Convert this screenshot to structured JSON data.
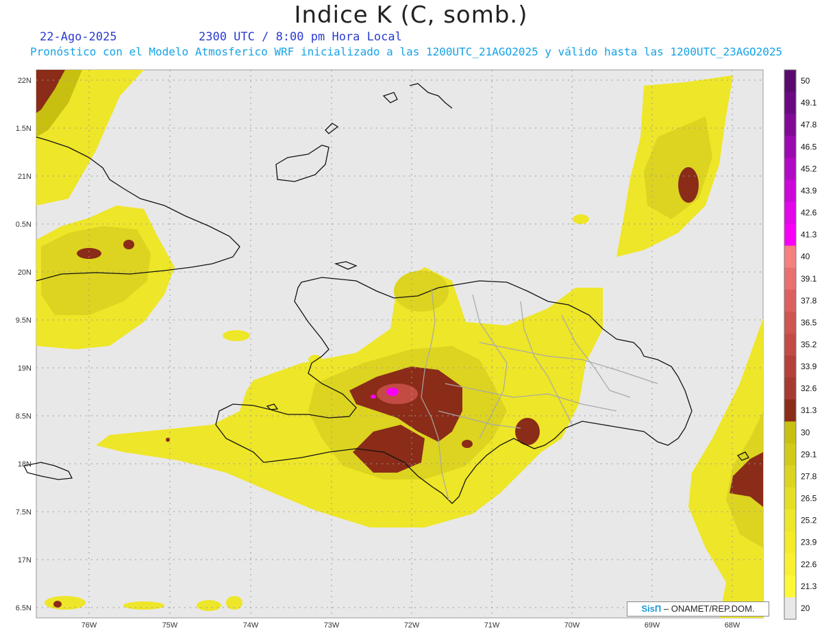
{
  "header": {
    "title": "Indice K (C, somb.)",
    "date": "22-Ago-2025",
    "time": "2300 UTC / 8:00 pm Hora Local",
    "description": "Pronóstico con el Modelo Atmosferico WRF inicializado a las 1200UTC_21AGO2025 y válido hasta las  1200UTC_23AGO2025"
  },
  "map": {
    "background_color": "#e8e8e8",
    "lat_labels": [
      "22N",
      "1.5N",
      "21N",
      "0.5N",
      "20N",
      "9.5N",
      "19N",
      "8.5N",
      "18N",
      "7.5N",
      "17N",
      "6.5N"
    ],
    "lon_labels": [
      "76W",
      "75W",
      "74W",
      "73W",
      "72W",
      "71W",
      "70W",
      "69W",
      "68W"
    ]
  },
  "colorbar": {
    "labels": [
      "50",
      "49.1",
      "47.8",
      "46.5",
      "45.2",
      "43.9",
      "42.6",
      "41.3",
      "40",
      "39.1",
      "37.8",
      "36.5",
      "35.2",
      "33.9",
      "32.6",
      "31.3",
      "30",
      "29.1",
      "27.8",
      "26.5",
      "25.2",
      "23.9",
      "22.6",
      "21.3",
      "20"
    ],
    "colors": [
      "#5a0a6e",
      "#6a0a80",
      "#800a96",
      "#9b0aae",
      "#b20ac4",
      "#cc08d8",
      "#e206ea",
      "#f800f8",
      "#f48080",
      "#e87070",
      "#dc6060",
      "#cf5650",
      "#c24c44",
      "#b4423a",
      "#a63a30",
      "#8a2c18",
      "#c8c010",
      "#d2ca18",
      "#dcd420",
      "#e6de24",
      "#eee628",
      "#f4ec2a",
      "#f8f030",
      "#fcf838",
      "#e8e8e8"
    ]
  },
  "credit": {
    "logo": "SisΠ",
    "text": "– ONAMET/REP.DOM."
  }
}
